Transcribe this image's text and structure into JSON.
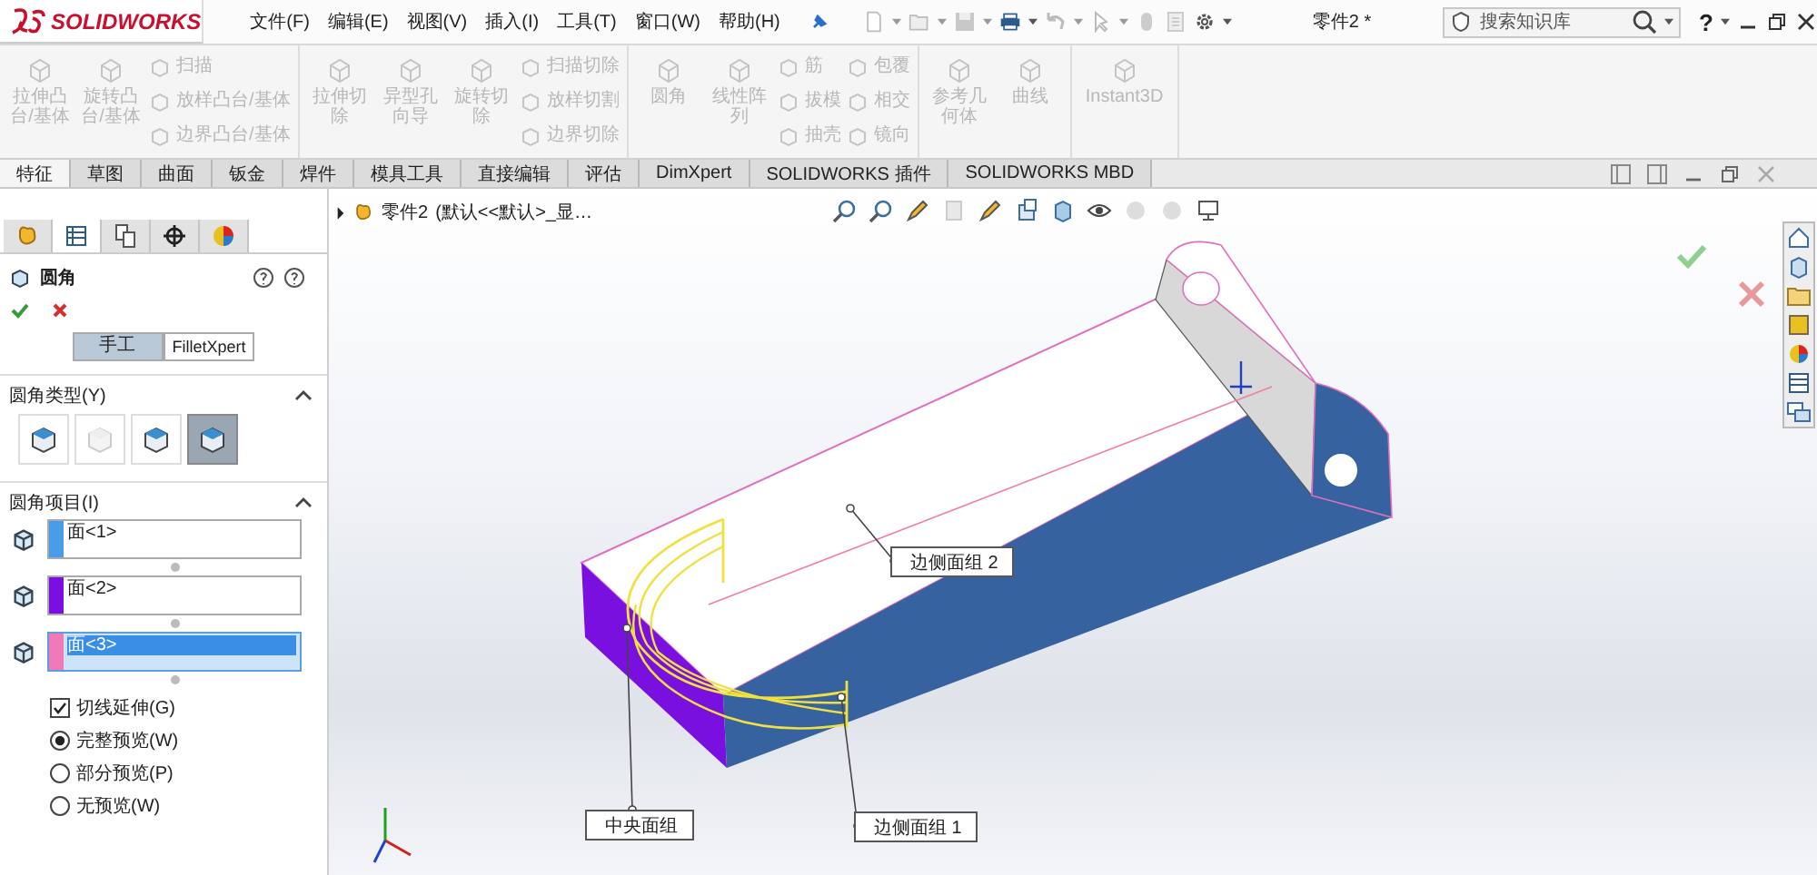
{
  "app": {
    "logo": "SOLIDWORKS"
  },
  "menu": [
    {
      "label": "文件(F)"
    },
    {
      "label": "编辑(E)"
    },
    {
      "label": "视图(V)"
    },
    {
      "label": "插入(I)"
    },
    {
      "label": "工具(T)"
    },
    {
      "label": "窗口(W)"
    },
    {
      "label": "帮助(H)"
    }
  ],
  "document_title": "零件2 *",
  "search": {
    "placeholder": "搜索知识库"
  },
  "help": "?",
  "ribbon": [
    {
      "columns": [
        {
          "kind": "large",
          "label": "拉伸凸台/基体",
          "disabled": true
        },
        {
          "kind": "large",
          "label": "旋转凸台/基体",
          "disabled": true
        },
        {
          "kind": "stack",
          "items": [
            {
              "label": "扫描",
              "disabled": true
            },
            {
              "label": "放样凸台/基体",
              "disabled": true
            },
            {
              "label": "边界凸台/基体",
              "disabled": true
            }
          ]
        }
      ]
    },
    {
      "columns": [
        {
          "kind": "large",
          "label": "拉伸切除",
          "disabled": true
        },
        {
          "kind": "large",
          "label": "异型孔向导",
          "disabled": true
        },
        {
          "kind": "large",
          "label": "旋转切除",
          "disabled": true
        },
        {
          "kind": "stack",
          "items": [
            {
              "label": "扫描切除",
              "disabled": true
            },
            {
              "label": "放样切割",
              "disabled": true
            },
            {
              "label": "边界切除",
              "disabled": true
            }
          ]
        }
      ]
    },
    {
      "columns": [
        {
          "kind": "large",
          "label": "圆角",
          "disabled": true
        },
        {
          "kind": "large",
          "label": "线性阵列",
          "disabled": true
        },
        {
          "kind": "stack",
          "items": [
            {
              "label": "筋",
              "disabled": true
            },
            {
              "label": "拔模",
              "disabled": true
            },
            {
              "label": "抽壳",
              "disabled": true
            }
          ]
        },
        {
          "kind": "stack",
          "items": [
            {
              "label": "包覆",
              "disabled": true
            },
            {
              "label": "相交",
              "disabled": true
            },
            {
              "label": "镜向",
              "disabled": true
            }
          ]
        }
      ]
    },
    {
      "columns": [
        {
          "kind": "large",
          "label": "参考几何体",
          "disabled": true
        },
        {
          "kind": "large",
          "label": "曲线",
          "disabled": true
        }
      ]
    },
    {
      "columns": [
        {
          "kind": "large",
          "label": "Instant3D",
          "disabled": true
        }
      ]
    }
  ],
  "tabs": [
    {
      "label": "特征",
      "selected": true
    },
    {
      "label": "草图",
      "selected": false
    },
    {
      "label": "曲面",
      "selected": false
    },
    {
      "label": "钣金",
      "selected": false
    },
    {
      "label": "焊件",
      "selected": false
    },
    {
      "label": "模具工具",
      "selected": false
    },
    {
      "label": "直接编辑",
      "selected": false
    },
    {
      "label": "评估",
      "selected": false
    },
    {
      "label": "DimXpert",
      "selected": false
    },
    {
      "label": "SOLIDWORKS 插件",
      "selected": false
    },
    {
      "label": "SOLIDWORKS MBD",
      "selected": false
    }
  ],
  "property_manager": {
    "tabs": [
      {
        "selected": false
      },
      {
        "selected": true
      },
      {
        "selected": false
      },
      {
        "selected": false
      },
      {
        "selected": false
      }
    ],
    "title": "圆角",
    "modes": [
      {
        "label": "手工",
        "selected": true
      },
      {
        "label": "FilletXpert",
        "selected": false
      }
    ],
    "fillet_type": {
      "title": "圆角类型(Y)",
      "expanded": true,
      "options": [
        {
          "selected": false,
          "disabled": false
        },
        {
          "selected": false,
          "disabled": true
        },
        {
          "selected": false,
          "disabled": false
        },
        {
          "selected": true,
          "disabled": false
        }
      ]
    },
    "fillet_items": {
      "title": "圆角项目(I)",
      "expanded": true,
      "faces": [
        {
          "label": "面<1>",
          "color": "#4a9be8",
          "selected": false
        },
        {
          "label": "面<2>",
          "color": "#7a10e0",
          "selected": false
        },
        {
          "label": "面<3>",
          "color": "#f07ab8",
          "selected": true
        }
      ]
    },
    "options": [
      {
        "kind": "checkbox",
        "label": "切线延伸(G)",
        "checked": true
      },
      {
        "kind": "radio",
        "label": "完整预览(W)",
        "selected": true
      },
      {
        "kind": "radio",
        "label": "部分预览(P)",
        "selected": false
      },
      {
        "kind": "radio",
        "label": "无预览(W)",
        "selected": false
      }
    ]
  },
  "tree": {
    "name": "零件2",
    "config": "(默认<<默认>_显…"
  },
  "callouts": [
    {
      "label": "边侧面组 2"
    },
    {
      "label": "中央面组"
    },
    {
      "label": "边侧面组 1"
    }
  ]
}
